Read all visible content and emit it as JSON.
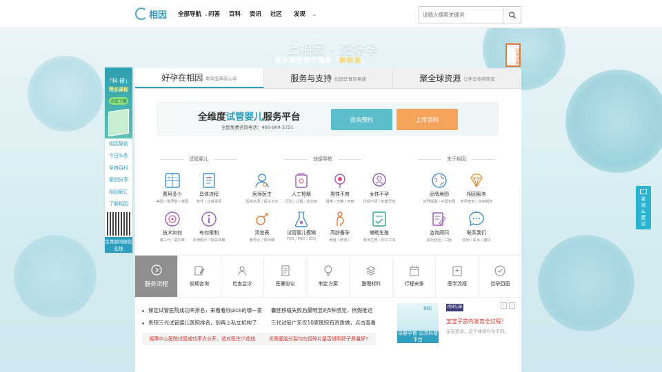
{
  "logo": {
    "text": "相因"
  },
  "nav": {
    "items": [
      "全部导航",
      "问答",
      "百科",
      "资讯",
      "社区",
      "发现"
    ]
  },
  "search": {
    "placeholder": "请输入搜索关键词"
  },
  "hero": {
    "slogan": "上相因 · 更好孕",
    "sub_prefix": "定义海外医疗服务「",
    "sub_highlight": "新标准",
    "sub_suffix": "」",
    "bookmark": "问卷调查"
  },
  "leftad": {
    "t1": "「科 研」",
    "t2": "精品课程",
    "t3": "点击了解",
    "links": [
      "相因导航",
      "今日头条",
      "孕育百科",
      "案例分享",
      "相因解汇",
      "了解相因"
    ],
    "qr_text": "生育顾问微信在线"
  },
  "rightfloat": {
    "text": "咨询&建议"
  },
  "tabs": [
    {
      "big": "好孕在相因",
      "small": "助孕宝典安心孕"
    },
    {
      "big": "服务与支持",
      "small": "出国孕育百事通"
    },
    {
      "big": "聚全球资源",
      "small": "让怀孕变得简单"
    }
  ],
  "banner": {
    "title_pre": "全维度",
    "title_acc": "试管婴儿",
    "title_post": "服务平台",
    "phone": "全国免费咨询电话：400-900-5751",
    "btn1": "咨询预约",
    "btn2": "上传资料"
  },
  "sections": [
    "试管婴儿",
    "快捷导航",
    "关于相因"
  ],
  "icons": [
    {
      "name": "费用多少",
      "desc": "美国 / 俄罗斯 / 泰国"
    },
    {
      "name": "具体流程",
      "desc": "条件 / 注意事项"
    },
    {
      "name": "医师医生",
      "desc": "医院名录 / 医生大全"
    },
    {
      "name": "人工授精",
      "desc": "区别 / 过程 / 成功率"
    },
    {
      "name": "男性不育",
      "desc": "弱精 / 无精 / 死精"
    },
    {
      "name": "女性不孕",
      "desc": "月经不调 / 卵巢早衰"
    },
    {
      "name": "品牌地图",
      "desc": "世界版图 / 中国布局"
    },
    {
      "name": "相因服务",
      "desc": "安孕管家 / 定制服务"
    },
    {
      "name": "技术如何",
      "desc": "第三代 / 成功率"
    },
    {
      "name": "有何限制",
      "desc": "法律顾问 / 相关政策"
    },
    {
      "name": "清宫表",
      "desc": "看男女 / 知孕期"
    },
    {
      "name": "试管婴儿模糊",
      "desc": "PGS / PGD / ICSI"
    },
    {
      "name": "高龄备孕",
      "desc": "绝经 / 卵泡少"
    },
    {
      "name": "辅助生殖",
      "desc": "单身生育 / 卵子冷冻"
    },
    {
      "name": "咨询顾问",
      "desc": "成功经验 / 二胎"
    },
    {
      "name": "联系我们",
      "desc": "咨询 / 投诉 / 建议"
    }
  ],
  "process": [
    "服务流程",
    "前期咨询",
    "检查会诊",
    "签署协议",
    "制定方案",
    "整理材料",
    "行程安排",
    "医学流程",
    "验孕回国"
  ],
  "news": {
    "left": [
      "保定试管医院成功率排名，来看看你pick的哪一家",
      "贵阳三代试管婴儿医院排名，别再上私立机构了"
    ],
    "right": [
      "囊胚移植失败后最明显的5种感觉，例假推迟",
      "三代试管广东仅10家医院有资质做，点击查看"
    ],
    "red": [
      "湘潭中心医院试管成功率大公开，选对医生少花钱",
      "优质胚胎分裂均匀但碎片是否说明卵子质量好?"
    ],
    "video_tag": "视频记录",
    "video_title": "宝宝子宫内发育全过程！",
    "video_desc": "孕在旅途，这个体验与众不同。",
    "thumb_caption": "母婴孕育 公共科普平台",
    "thumb_logo": "相因"
  }
}
